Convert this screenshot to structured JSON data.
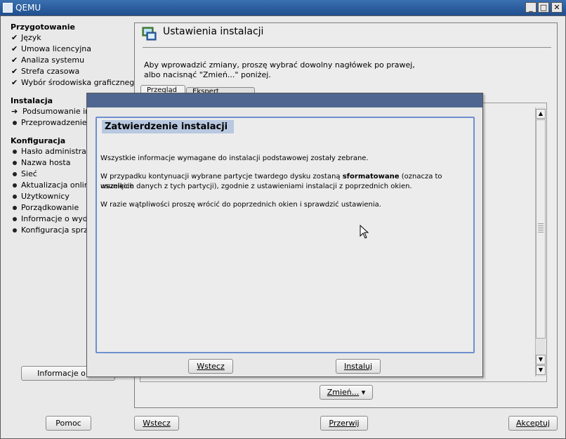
{
  "window": {
    "title": "QEMU",
    "minimize_glyph": "_",
    "maximize_glyph": "□",
    "close_glyph": "✕"
  },
  "sidebar": {
    "sections": [
      {
        "title": "Przygotowanie",
        "items": [
          {
            "label": "Język",
            "state": "done"
          },
          {
            "label": "Umowa licencyjna",
            "state": "done"
          },
          {
            "label": "Analiza systemu",
            "state": "done"
          },
          {
            "label": "Strefa czasowa",
            "state": "done"
          },
          {
            "label": "Wybór środowiska graficznego",
            "state": "done"
          }
        ]
      },
      {
        "title": "Instalacja",
        "items": [
          {
            "label": "Podsumowanie ins",
            "state": "current"
          },
          {
            "label": "Przeprowadzenie i",
            "state": "pending"
          }
        ]
      },
      {
        "title": "Konfiguracja",
        "items": [
          {
            "label": "Hasło administrato",
            "state": "pending"
          },
          {
            "label": "Nazwa hosta",
            "state": "pending"
          },
          {
            "label": "Sieć",
            "state": "pending"
          },
          {
            "label": "Aktualizacja online",
            "state": "pending"
          },
          {
            "label": "Użytkownicy",
            "state": "pending"
          },
          {
            "label": "Porządkowanie",
            "state": "pending"
          },
          {
            "label": "Informacje o wyda",
            "state": "pending"
          },
          {
            "label": "Konfiguracja sprzę",
            "state": "pending"
          }
        ]
      }
    ],
    "release_notes_button": "Informacje o wy",
    "check_glyph": "✔",
    "arrow_glyph": "➔"
  },
  "main": {
    "title": "Ustawienia instalacji",
    "description_line1": "Aby wprowadzić zmiany, proszę wybrać dowolny nagłówek po prawej,",
    "description_line2": "albo nacisnąć \"Zmień...\" poniżej.",
    "tab_overview": "Przegląd",
    "tab_expert": "Ekspert",
    "change_button": "Zmień...",
    "change_arrow": "▾"
  },
  "dialog": {
    "heading": "Zatwierdzenie instalacji",
    "paragraph1": "Wszystkie informacje wymagane do instalacji podstawowej zostały zebrane.",
    "paragraph2_prefix": "W przypadku kontynuacji wybrane partycje twardego dysku zostaną ",
    "paragraph2_bold": "sformatowane",
    "paragraph2_suffix": " (oznacza to usunięcie",
    "paragraph2_line2": "wszelkich danych z tych partycji), zgodnie z ustawieniami instalacji z poprzednich okien.",
    "paragraph3": "W razie wątpliwości proszę wrócić do poprzednich okien i sprawdzić ustawienia.",
    "back_button": "Wstecz",
    "install_button": "Instaluj"
  },
  "footer": {
    "help_button": "Pomoc",
    "back_button": "Wstecz",
    "abort_button": "Przerwij",
    "accept_button": "Akceptuj"
  },
  "colors": {
    "titlebar": "#2a5a9c",
    "dialog_titlebar": "#4f6790",
    "dialog_border": "#6e8fd0",
    "heading_bg": "#b8c8e0"
  }
}
